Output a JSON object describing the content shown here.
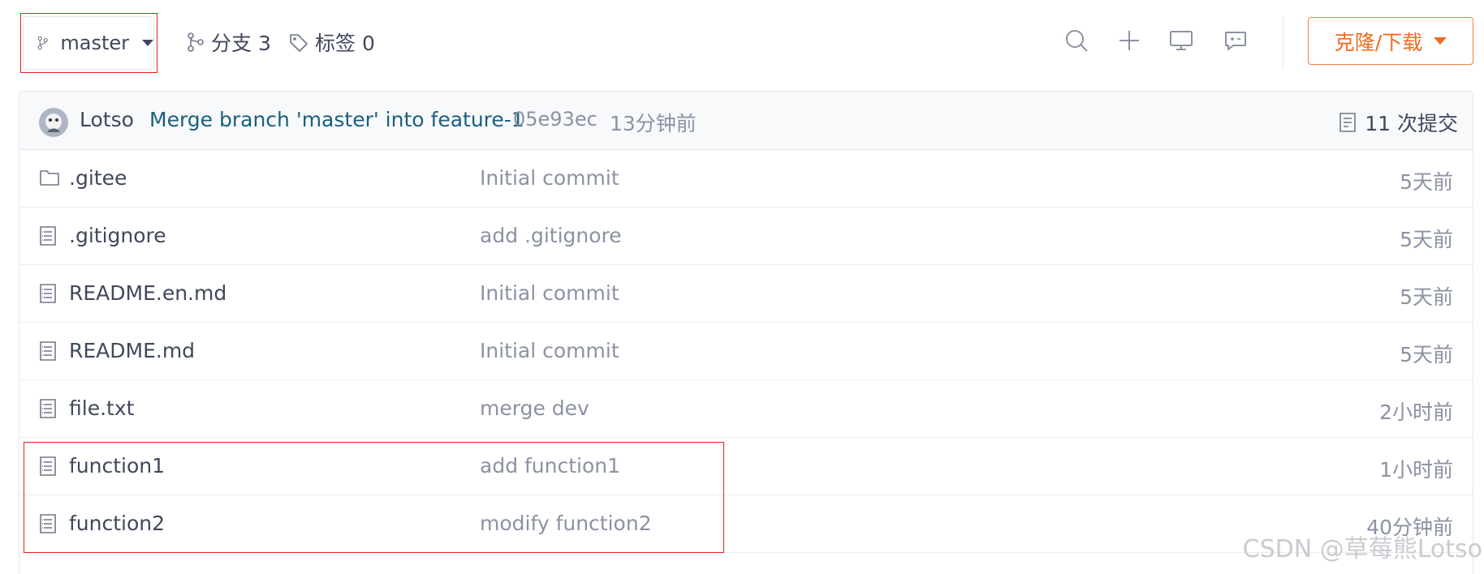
{
  "toolbar": {
    "branch": "master",
    "branches_label": "分支 3",
    "tags_label": "标签 0",
    "clone_label": "克隆/下载",
    "icons": [
      "search-icon",
      "plus-icon",
      "monitor-icon",
      "comment-icon"
    ]
  },
  "commit": {
    "author": "Lotso",
    "message": "Merge branch 'master' into feature-1",
    "hash": "05e93ec",
    "time": "13分钟前",
    "count_label": "11 次提交"
  },
  "files": [
    {
      "name": ".gitee",
      "type": "folder",
      "message": "Initial commit",
      "time": "5天前"
    },
    {
      "name": ".gitignore",
      "type": "file",
      "message": "add .gitignore",
      "time": "5天前"
    },
    {
      "name": "README.en.md",
      "type": "file",
      "message": "Initial commit",
      "time": "5天前"
    },
    {
      "name": "README.md",
      "type": "file",
      "message": "Initial commit",
      "time": "5天前"
    },
    {
      "name": "file.txt",
      "type": "file",
      "message": "merge dev",
      "time": "2小时前"
    },
    {
      "name": "function1",
      "type": "file",
      "message": "add function1",
      "time": "1小时前"
    },
    {
      "name": "function2",
      "type": "file",
      "message": "modify function2",
      "time": "40分钟前"
    }
  ],
  "watermark": "CSDN @草莓熊Lotso",
  "colors": {
    "accent": "#ef6c1e",
    "link": "#1b5f7c",
    "highlight": "#e02020",
    "text": "#40485b",
    "muted": "#8c92a4"
  }
}
